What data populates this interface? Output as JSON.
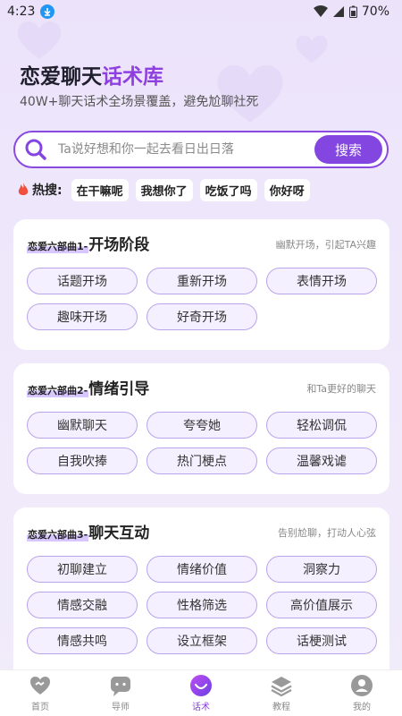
{
  "status": {
    "time": "4:23",
    "battery": "70%"
  },
  "header": {
    "title_main": "恋爱聊天",
    "title_accent": "话术库",
    "subtitle": "40W+聊天话术全场景覆盖，避免尬聊社死"
  },
  "search": {
    "placeholder": "Ta说好想和你一起去看日出日落",
    "button": "搜索"
  },
  "hot": {
    "label": "热搜:",
    "tags": [
      "在干嘛呢",
      "我想你了",
      "吃饭了吗",
      "你好呀"
    ]
  },
  "sections": [
    {
      "prefix": "恋爱六部曲1-",
      "name": "开场阶段",
      "desc": "幽默开场，引起TA兴趣",
      "chips": [
        "话题开场",
        "重新开场",
        "表情开场",
        "趣味开场",
        "好奇开场"
      ]
    },
    {
      "prefix": "恋爱六部曲2-",
      "name": "情绪引导",
      "desc": "和Ta更好的聊天",
      "chips": [
        "幽默聊天",
        "夸夸她",
        "轻松调侃",
        "自我吹捧",
        "热门梗点",
        "温馨戏谑"
      ]
    },
    {
      "prefix": "恋爱六部曲3-",
      "name": "聊天互动",
      "desc": "告别尬聊，打动人心弦",
      "chips": [
        "初聊建立",
        "情绪价值",
        "洞察力",
        "情感交融",
        "性格筛选",
        "高价值展示",
        "情感共鸣",
        "设立框架",
        "话梗测试"
      ]
    }
  ],
  "tabs": [
    {
      "label": "首页",
      "icon": "heart-home-icon"
    },
    {
      "label": "导师",
      "icon": "chat-bubble-icon"
    },
    {
      "label": "话术",
      "icon": "smile-chat-icon",
      "active": true
    },
    {
      "label": "教程",
      "icon": "layers-icon"
    },
    {
      "label": "我的",
      "icon": "user-icon"
    }
  ],
  "colors": {
    "accent": "#8446e0",
    "title_accent": "#8e3fe0"
  }
}
